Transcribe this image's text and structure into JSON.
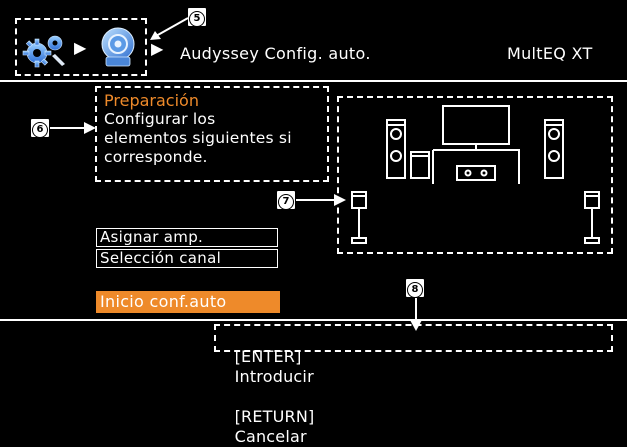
{
  "header": {
    "breadcrumb_arrow": "▶",
    "breadcrumb_item": "Audyssey Config. auto.",
    "right_label": "MultEQ XT"
  },
  "callouts": {
    "c5": "5",
    "c6": "6",
    "c7": "7",
    "c8": "8"
  },
  "instructions": {
    "title": "Preparación",
    "lines": [
      "Configurar los",
      "elementos siguientes si",
      "corresponde."
    ]
  },
  "menu": {
    "assign_amp": "Asignar amp.",
    "channel_select": "Selección canal",
    "start": "Inicio conf.auto"
  },
  "footer": {
    "enter_key": "[ENTER]",
    "enter_label": "Introducir",
    "return_key": "[RETURN]",
    "return_label": "Cancelar"
  },
  "colors": {
    "accent": "#ee8a2a",
    "background": "#000000",
    "text": "#ffffff"
  },
  "icons": [
    "settings-gears-icon",
    "speaker-setup-icon",
    "arrow-right-icon"
  ]
}
